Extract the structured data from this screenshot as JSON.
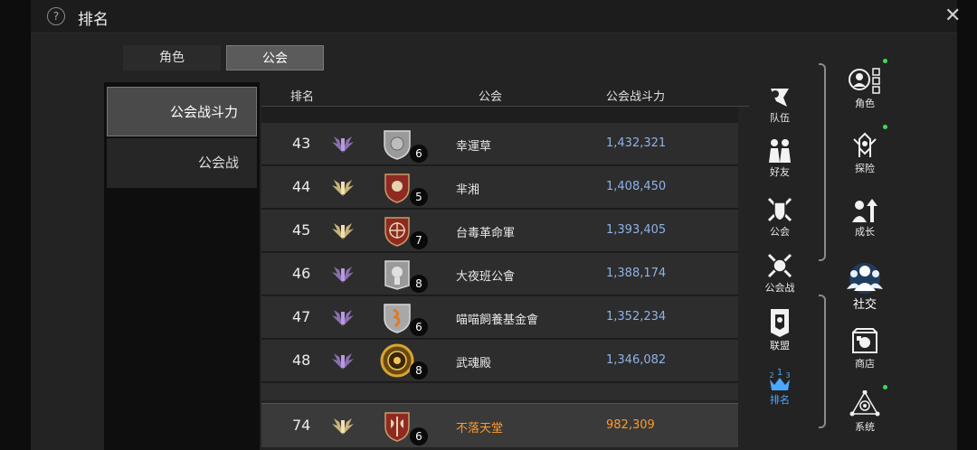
{
  "header": {
    "title": "排名",
    "help_icon": "?",
    "close_icon": "✕"
  },
  "tabs": [
    {
      "label": "角色"
    },
    {
      "label": "公会"
    }
  ],
  "categories": [
    {
      "label": "公会战斗力"
    },
    {
      "label": "公会战"
    }
  ],
  "table": {
    "headers": {
      "rank": "排名",
      "guild": "公会",
      "power": "公会战斗力"
    },
    "rows": [
      {
        "rank": "43",
        "level": "6",
        "name": "幸運草",
        "power": "1,432,321",
        "wing": "purple",
        "crest": "silver-shield"
      },
      {
        "rank": "44",
        "level": "5",
        "name": "芈湘",
        "power": "1,408,450",
        "wing": "gold",
        "crest": "red-shield"
      },
      {
        "rank": "45",
        "level": "7",
        "name": "台毒革命軍",
        "power": "1,393,405",
        "wing": "gold",
        "crest": "red-compass"
      },
      {
        "rank": "46",
        "level": "8",
        "name": "大夜班公會",
        "power": "1,388,174",
        "wing": "purple",
        "crest": "silver-tower"
      },
      {
        "rank": "47",
        "level": "6",
        "name": "喵喵飼養基金會",
        "power": "1,352,234",
        "wing": "purple",
        "crest": "silver-shield-orange"
      },
      {
        "rank": "48",
        "level": "8",
        "name": "武魂殿",
        "power": "1,346,082",
        "wing": "purple",
        "crest": "gold-wreath"
      }
    ],
    "my_guild": {
      "rank": "74",
      "level": "6",
      "name": "不落天堂",
      "power": "982,309",
      "wing": "gold",
      "crest": "red-axe"
    }
  },
  "social_nav": [
    {
      "label": "队伍",
      "icon": "party-icon"
    },
    {
      "label": "好友",
      "icon": "friends-icon"
    },
    {
      "label": "公会",
      "icon": "guild-icon"
    },
    {
      "label": "公会战",
      "icon": "guild-war-icon"
    },
    {
      "label": "联盟",
      "icon": "alliance-icon"
    },
    {
      "label": "排名",
      "icon": "ranking-icon",
      "active": true
    }
  ],
  "main_nav": [
    {
      "label": "角色",
      "icon": "character-icon",
      "notify": true
    },
    {
      "label": "探险",
      "icon": "adventure-icon",
      "notify": true
    },
    {
      "label": "成长",
      "icon": "growth-icon",
      "notify": false
    },
    {
      "label": "社交",
      "icon": "social-icon",
      "notify": false,
      "active": true
    },
    {
      "label": "商店",
      "icon": "shop-icon",
      "notify": false
    },
    {
      "label": "系统",
      "icon": "system-icon",
      "notify": true
    }
  ],
  "colors": {
    "accent_blue": "#8fb2e6",
    "my_guild_orange": "#ff9a2a",
    "active_nav": "#4aa8ff",
    "notify_green": "#3ddc56"
  }
}
